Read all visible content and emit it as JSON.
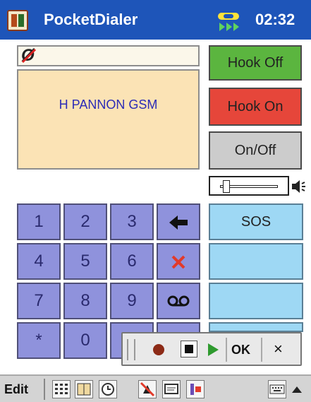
{
  "titlebar": {
    "app_name": "PocketDialer",
    "time": "02:32"
  },
  "number_field": {
    "symbol": "Ø"
  },
  "display": {
    "operator": "H PANNON GSM"
  },
  "right_buttons": {
    "hook_off": "Hook Off",
    "hook_on": "Hook On",
    "on_off": "On/Off",
    "sos": "SOS"
  },
  "keypad": {
    "keys": [
      "1",
      "2",
      "3",
      "4",
      "5",
      "6",
      "7",
      "8",
      "9",
      "*",
      "0"
    ]
  },
  "recorder": {
    "ok": "OK",
    "close": "×"
  },
  "bottom_bar": {
    "edit": "Edit"
  },
  "colors": {
    "titlebar": "#1e55b9",
    "hook_off": "#5bb53f",
    "hook_on": "#e6463a",
    "keypad": "#8f92dc",
    "display": "#fbe3b5",
    "light_button": "#9ed8f4"
  }
}
